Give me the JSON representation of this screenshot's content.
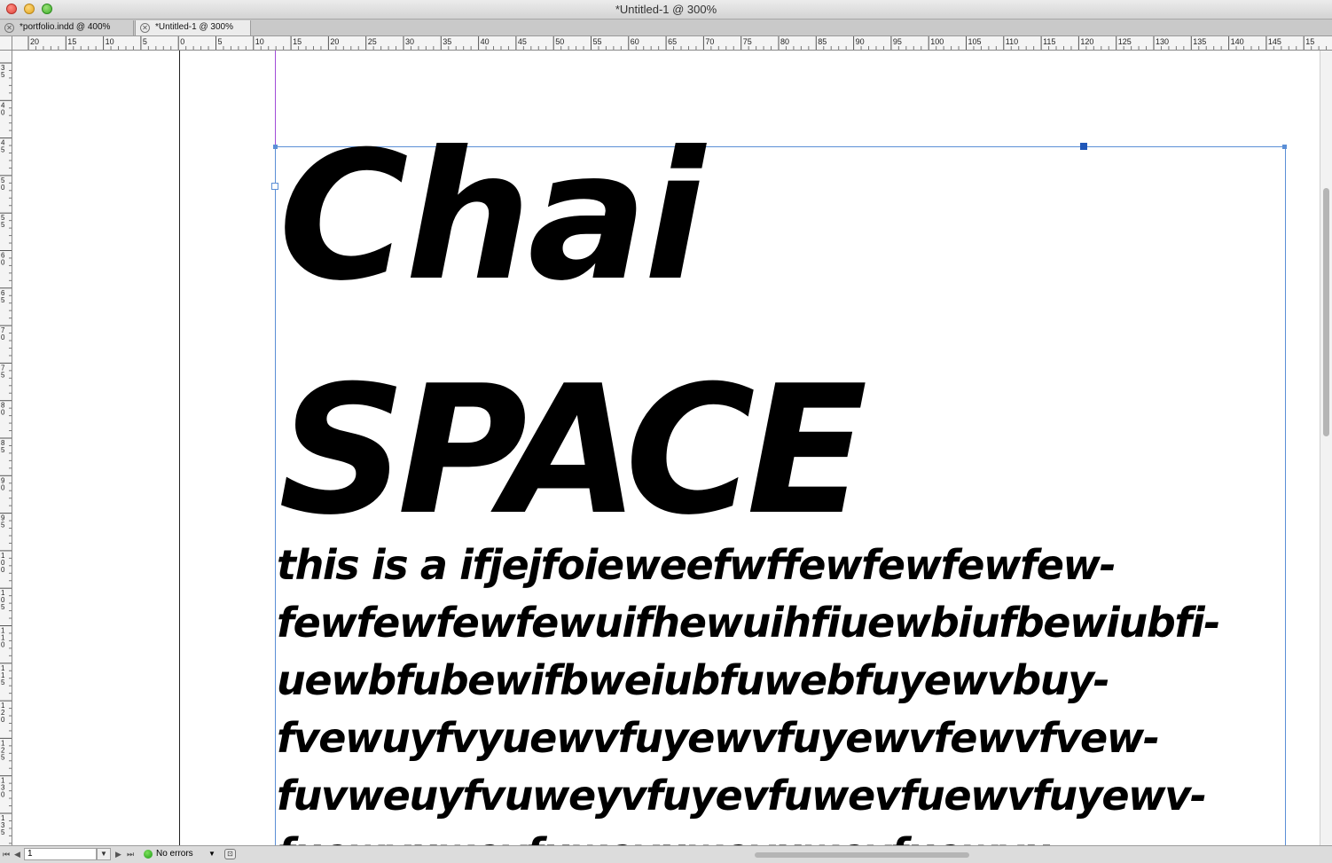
{
  "window": {
    "title": "*Untitled-1 @ 300%"
  },
  "tabs": [
    {
      "label": "*portfolio.indd @ 400%",
      "active": false
    },
    {
      "label": "*Untitled-1 @ 300%",
      "active": true
    }
  ],
  "rulers": {
    "top_labels": [
      "20",
      "15",
      "10",
      "5",
      "0",
      "5",
      "10",
      "15",
      "20",
      "25",
      "30",
      "35",
      "40",
      "45",
      "50",
      "55",
      "60",
      "65",
      "70",
      "75",
      "80",
      "85",
      "90",
      "95",
      "100",
      "105",
      "110",
      "115",
      "120",
      "125",
      "130",
      "135",
      "140",
      "145",
      "15"
    ],
    "left_labels": [
      "35",
      "40",
      "45",
      "50",
      "55",
      "60",
      "65",
      "70",
      "75",
      "80",
      "85",
      "90",
      "95",
      "100",
      "105",
      "110",
      "115",
      "120",
      "125",
      "130",
      "135"
    ]
  },
  "document": {
    "headline_1": "Chai",
    "headline_2": "SPACE",
    "body_lines": [
      "this is a ifjejfoieweefwffewfewfewfew-",
      "fewfewfewfewuifhewuihfiuewbiufbewiubfi-",
      "uewbfubewifbweiubfuwebfuyewvbuy-",
      "fvewuyfvyuewvfuyewvfuyewvfewvfvew-",
      "fuvweuyfvuweyvfuyevfuwevfuewvfuyewv-",
      "fuewvuwevfuwevuwevuwevfuewvu"
    ]
  },
  "status_bar": {
    "page_number": "1",
    "preflight_status": "No errors",
    "preflight_color": "#1c9a14"
  },
  "colors": {
    "frame_selection": "#5b8fd6",
    "guide": "#a24bd8"
  }
}
